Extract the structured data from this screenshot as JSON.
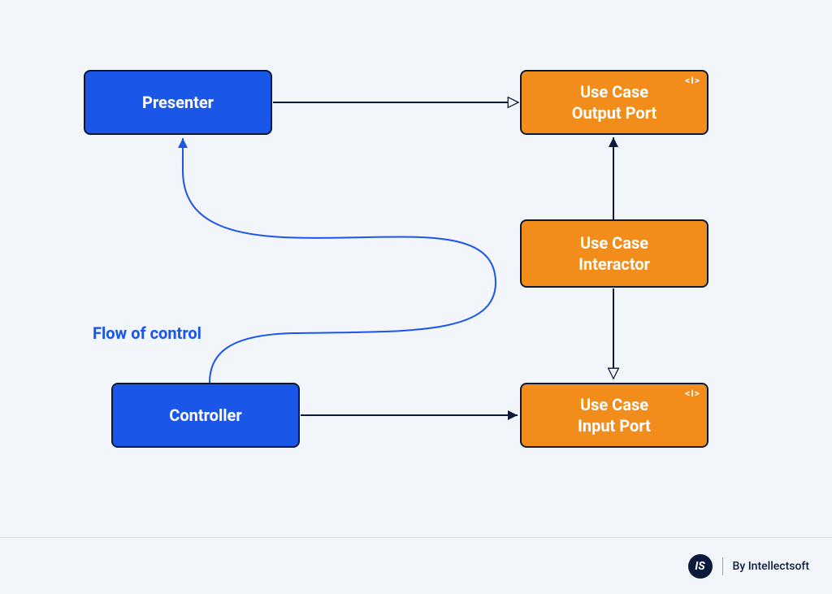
{
  "boxes": {
    "presenter": "Presenter",
    "controller": "Controller",
    "output_port": "Use Case\nOutput Port",
    "interactor": "Use Case\nInteractor",
    "input_port": "Use Case\nInput Port"
  },
  "labels": {
    "flow_of_control": "Flow of control"
  },
  "footer": {
    "logo_glyph": "IS",
    "byline": "By Intellectsoft"
  },
  "glyphs": {
    "interface": "<I>"
  },
  "colors": {
    "blue": "#1a56e8",
    "orange": "#f28c1a",
    "line_dark": "#0b1a3a",
    "bg": "#f2f6fa"
  },
  "arrows": [
    {
      "from": "presenter",
      "to": "output_port",
      "style": "open",
      "color": "dark"
    },
    {
      "from": "controller",
      "to": "input_port",
      "style": "solid",
      "color": "dark"
    },
    {
      "from": "interactor",
      "to": "output_port",
      "style": "solid",
      "color": "dark"
    },
    {
      "from": "interactor",
      "to": "input_port",
      "style": "open",
      "color": "dark"
    },
    {
      "from": "controller",
      "to": "presenter",
      "style": "solid",
      "color": "blue",
      "note": "flow of control curved"
    }
  ]
}
